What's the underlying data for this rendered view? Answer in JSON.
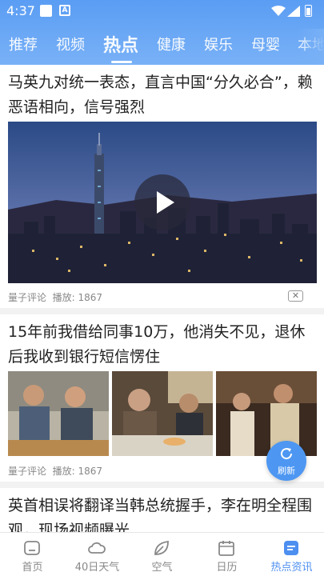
{
  "status": {
    "time": "4:37",
    "icon_b": "A"
  },
  "tabs": [
    {
      "label": "推荐"
    },
    {
      "label": "视频"
    },
    {
      "label": "热点"
    },
    {
      "label": "健康"
    },
    {
      "label": "娱乐"
    },
    {
      "label": "母婴"
    },
    {
      "label": "本地"
    }
  ],
  "active_tab": "热点",
  "articles": [
    {
      "title": "马英九对统一表态，直言中国“分久必合”，赖恶语相向，信号强烈",
      "source": "量子评论",
      "plays": "播放: 1867",
      "type": "video"
    },
    {
      "title": "15年前我借给同事10万，他消失不见，退休后我收到银行短信愣住",
      "source": "量子评论",
      "plays": "播放: 1867",
      "type": "three-images"
    },
    {
      "title": "英首相误将翻译当韩总统握手，李在明全程围观，现场视频曝光"
    }
  ],
  "close_label": "✕",
  "refresh": {
    "label": "刷新"
  },
  "bottom_nav": [
    {
      "label": "首页",
      "icon": "home-icon"
    },
    {
      "label": "40日天气",
      "icon": "cloud-icon"
    },
    {
      "label": "空气",
      "icon": "leaf-icon"
    },
    {
      "label": "日历",
      "icon": "calendar-icon"
    },
    {
      "label": "热点资讯",
      "icon": "news-icon"
    }
  ],
  "colors": {
    "accent": "#4d8ff0",
    "header": "#5a9df4"
  }
}
